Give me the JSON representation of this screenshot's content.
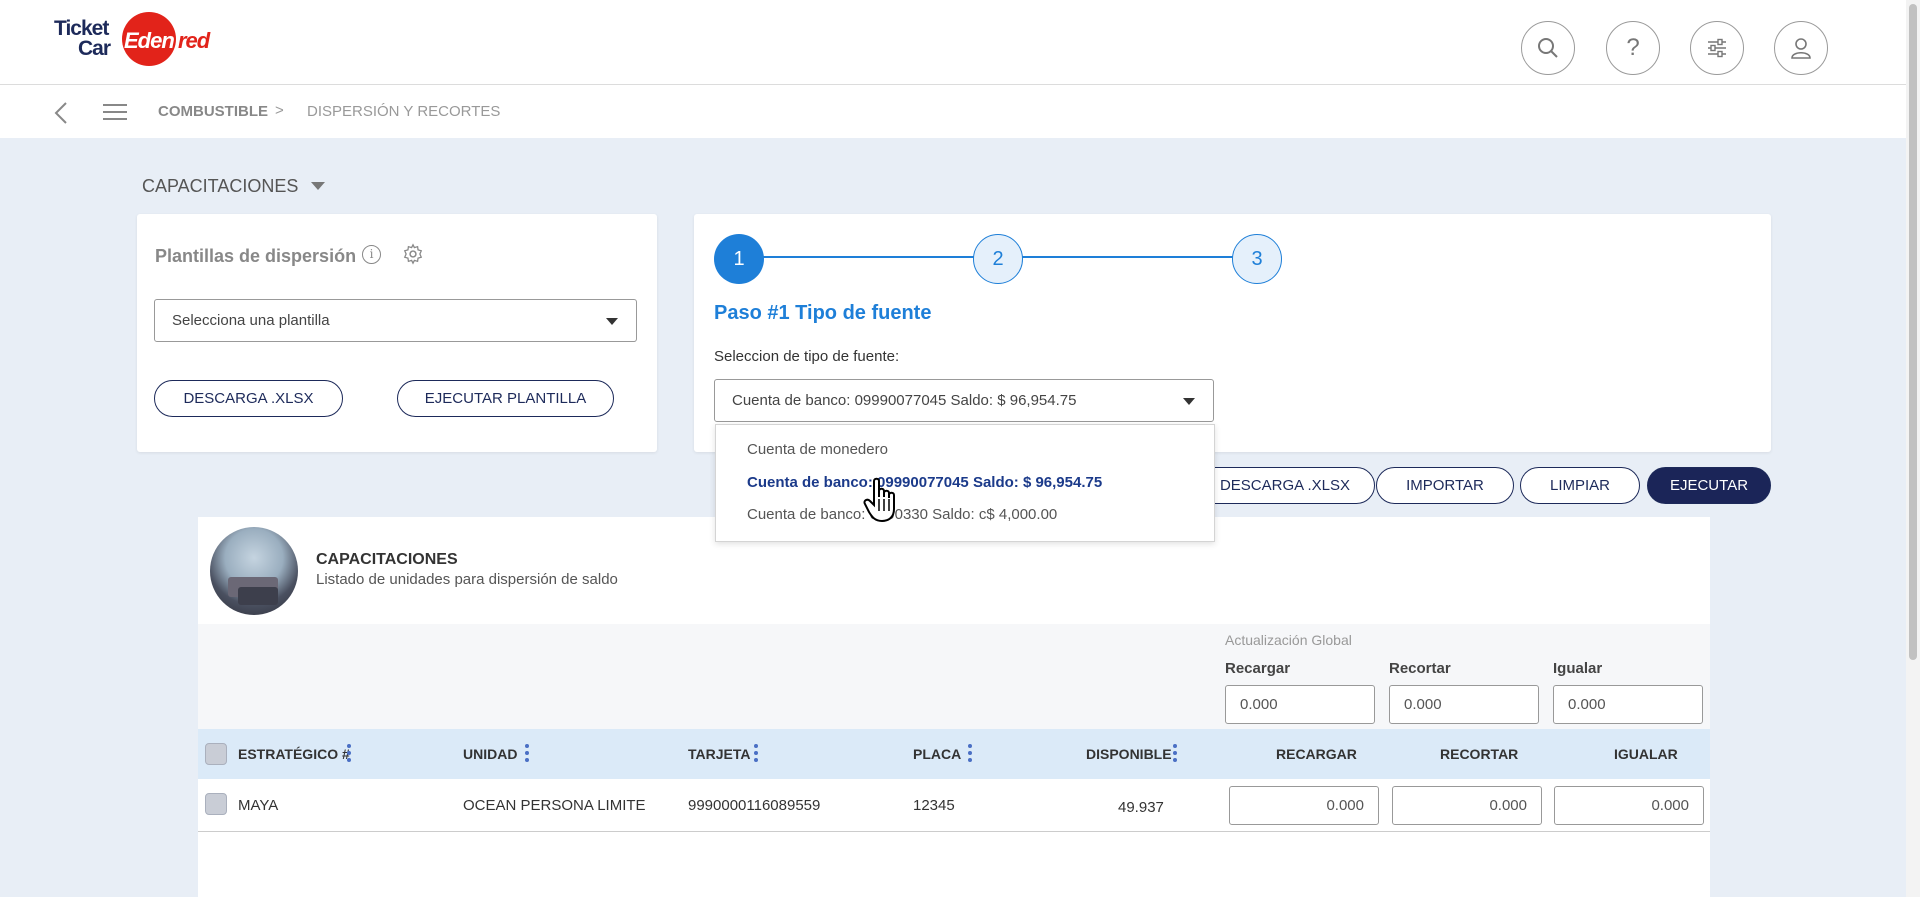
{
  "header": {
    "logo": {
      "ticket": "Ticket",
      "car": "Car",
      "edenred_a": "Eden",
      "edenred_b": "red"
    },
    "icons": [
      "search-icon",
      "help-icon",
      "filters-icon",
      "user-icon"
    ],
    "help_glyph": "?"
  },
  "breadcrumb": {
    "items": [
      "COMBUSTIBLE",
      "DISPERSIÓN Y RECORTES"
    ],
    "separator": ">"
  },
  "section": {
    "title": "CAPACITACIONES"
  },
  "templates": {
    "title": "Plantillas de dispersión",
    "info_glyph": "i",
    "select_placeholder": "Selecciona una plantilla",
    "download_label": "DESCARGA .XLSX",
    "execute_label": "EJECUTAR PLANTILLA"
  },
  "wizard": {
    "steps": [
      "1",
      "2",
      "3"
    ],
    "current_step": "1",
    "step_title": "Paso #1 Tipo de fuente",
    "source_label": "Seleccion de tipo de fuente:",
    "source_selected": "Cuenta de banco: 09990077045  Saldo: $ 96,954.75",
    "options": [
      "Cuenta de monedero",
      "Cuenta de banco: 09990077045  Saldo: $ 96,954.75",
      "Cuenta de banco: 0000330  Saldo: c$ 4,000.00"
    ]
  },
  "actions": {
    "download_label": "DESCARGA .XLSX",
    "import_label": "IMPORTAR",
    "clear_label": "LIMPIAR",
    "execute_label": "EJECUTAR"
  },
  "units": {
    "title": "CAPACITACIONES",
    "subtitle": "Listado de unidades para dispersión de saldo",
    "global_update": {
      "title": "Actualización Global",
      "recargar_label": "Recargar",
      "recortar_label": "Recortar",
      "igualar_label": "Igualar",
      "recargar_value": "0.000",
      "recortar_value": "0.000",
      "igualar_value": "0.000"
    },
    "columns": [
      "ESTRATÉGICO #",
      "UNIDAD",
      "TARJETA",
      "PLACA",
      "DISPONIBLE",
      "RECARGAR",
      "RECORTAR",
      "IGUALAR"
    ],
    "rows": [
      {
        "estrategico": "MAYA",
        "unidad": "OCEAN PERSONA LIMITE",
        "tarjeta": "9990000116089559",
        "placa": "12345",
        "disponible": "49.937",
        "recargar": "0.000",
        "recortar": "0.000",
        "igualar": "0.000"
      }
    ]
  },
  "colors": {
    "primary_blue": "#1e7fd8",
    "navy": "#1b2558",
    "brand_red": "#e2231a",
    "page_bg": "#e8eef6",
    "header_row": "#dbeaf8"
  }
}
